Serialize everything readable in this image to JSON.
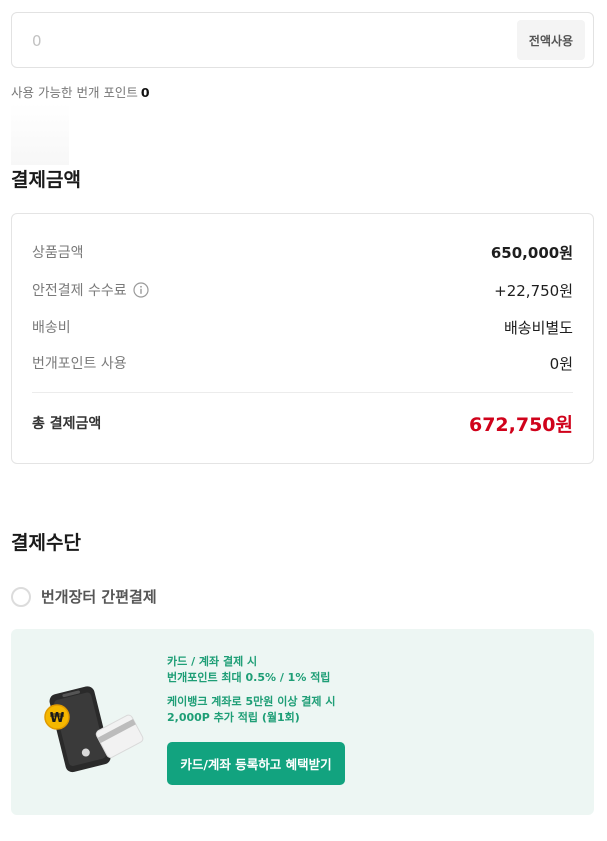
{
  "point_input": {
    "value": "",
    "placeholder": "0",
    "use_all_label": "전액사용"
  },
  "available_points": {
    "label": "사용 가능한 번개 포인트",
    "value": "0"
  },
  "payment_amount": {
    "title": "결제금액",
    "rows": [
      {
        "label": "상품금액",
        "value": "650,000원"
      },
      {
        "label": "안전결제 수수료",
        "value": "+22,750원"
      },
      {
        "label": "배송비",
        "value": "배송비별도"
      },
      {
        "label": "번개포인트 사용",
        "value": "0원"
      }
    ],
    "total": {
      "label": "총 결제금액",
      "value": "672,750원"
    }
  },
  "payment_method": {
    "title": "결제수단",
    "option_label": "번개장터 간편결제"
  },
  "promo": {
    "line1": "카드 / 계좌 결제 시",
    "line2": "번개포인트 최대 0.5% / 1% 적립",
    "line3": "케이뱅크 계좌로 5만원 이상 결제 시",
    "line4": "2,000P 추가 적립 (월1회)",
    "button_label": "카드/계좌 등록하고 혜택받기"
  },
  "colors": {
    "accent_red": "#d0021b",
    "accent_green": "#12a37f",
    "promo_bg": "#edf6f3"
  },
  "icons": {
    "info": "info-circle-icon",
    "won_coin": "won-coin-icon",
    "phone": "phone-icon",
    "card": "card-icon"
  }
}
